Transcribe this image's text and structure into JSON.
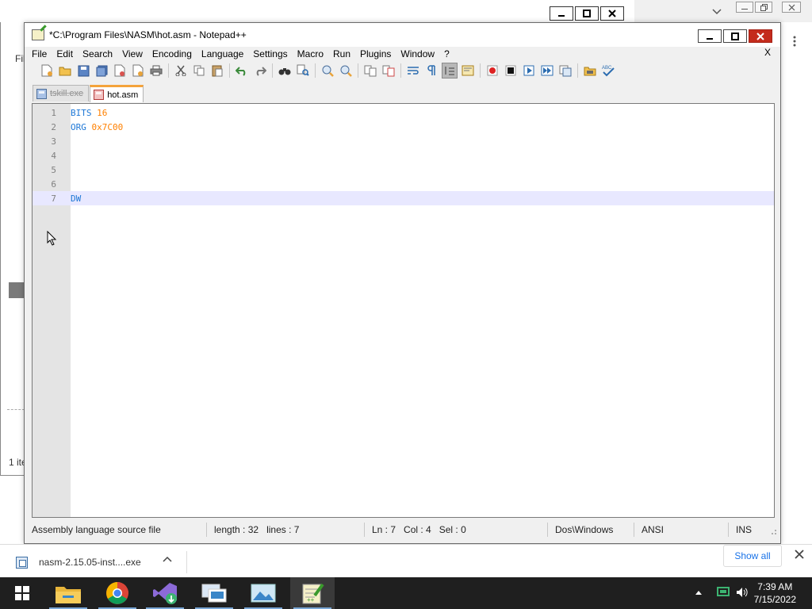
{
  "background": {
    "explorer_fragments": [
      "Fil",
      "1 ite"
    ],
    "colors": {
      "selected_row": "#7a7a7a"
    }
  },
  "window": {
    "title": "*C:\\Program Files\\NASM\\hot.asm - Notepad++",
    "controls": [
      "minimize-icon",
      "maximize-icon",
      "close-icon"
    ]
  },
  "menu": {
    "items": [
      "File",
      "Edit",
      "Search",
      "View",
      "Encoding",
      "Language",
      "Settings",
      "Macro",
      "Run",
      "Plugins",
      "Window",
      "?"
    ],
    "close_doc": "X"
  },
  "toolbar": {
    "icons": [
      "new-file-icon",
      "open-file-icon",
      "save-icon",
      "save-all-icon",
      "close-icon",
      "close-all-icon",
      "print-icon",
      "cut-icon",
      "copy-icon",
      "paste-icon",
      "undo-icon",
      "redo-icon",
      "find-icon",
      "replace-icon",
      "zoom-in-icon",
      "zoom-out-icon",
      "sync-vertical-icon",
      "sync-horizontal-icon",
      "word-wrap-icon",
      "show-all-chars-icon",
      "indent-guide-icon",
      "doc-map-icon",
      "record-macro-icon",
      "stop-record-icon",
      "play-macro-icon",
      "run-macro-multiple-icon",
      "save-macro-icon",
      "folder-workspace-icon",
      "spell-check-icon"
    ]
  },
  "tabs": [
    {
      "label": "tskill.exe",
      "active": false,
      "icon": "disk-icon"
    },
    {
      "label": "hot.asm",
      "active": true,
      "icon": "red-disk-icon"
    }
  ],
  "editor": {
    "lines": [
      {
        "number": "1",
        "tokens": [
          {
            "text": "BITS",
            "kind": "kw"
          },
          {
            "text": " ",
            "kind": "plain"
          },
          {
            "text": "16",
            "kind": "num"
          }
        ]
      },
      {
        "number": "2",
        "tokens": [
          {
            "text": "ORG",
            "kind": "kw"
          },
          {
            "text": " ",
            "kind": "plain"
          },
          {
            "text": "0x7C00",
            "kind": "num"
          }
        ]
      },
      {
        "number": "3",
        "tokens": []
      },
      {
        "number": "4",
        "tokens": []
      },
      {
        "number": "5",
        "tokens": []
      },
      {
        "number": "6",
        "tokens": []
      },
      {
        "number": "7",
        "tokens": [
          {
            "text": "DW",
            "kind": "kw"
          }
        ],
        "current": true
      }
    ],
    "colors": {
      "keyword": "#1f78d6",
      "number": "#ff8000",
      "current_line": "#e8e8ff",
      "gutter": "#e4e4e4"
    }
  },
  "status": {
    "file_type": "Assembly language source file",
    "length": "length : 32",
    "lines": "lines : 7",
    "ln": "Ln : 7",
    "col": "Col : 4",
    "sel": "Sel : 0",
    "eol": "Dos\\Windows",
    "encoding": "ANSI",
    "mode": "INS"
  },
  "downloads": {
    "file_name": "nasm-2.15.05-inst....exe",
    "show_all": "Show all"
  },
  "taskbar": {
    "apps": [
      "start-icon",
      "file-explorer-icon",
      "chrome-icon",
      "visual-studio-icon",
      "remote-desktop-icon",
      "image-viewer-icon",
      "notepad-plus-plus-icon"
    ],
    "time": "7:39 AM",
    "date": "7/15/2022"
  }
}
